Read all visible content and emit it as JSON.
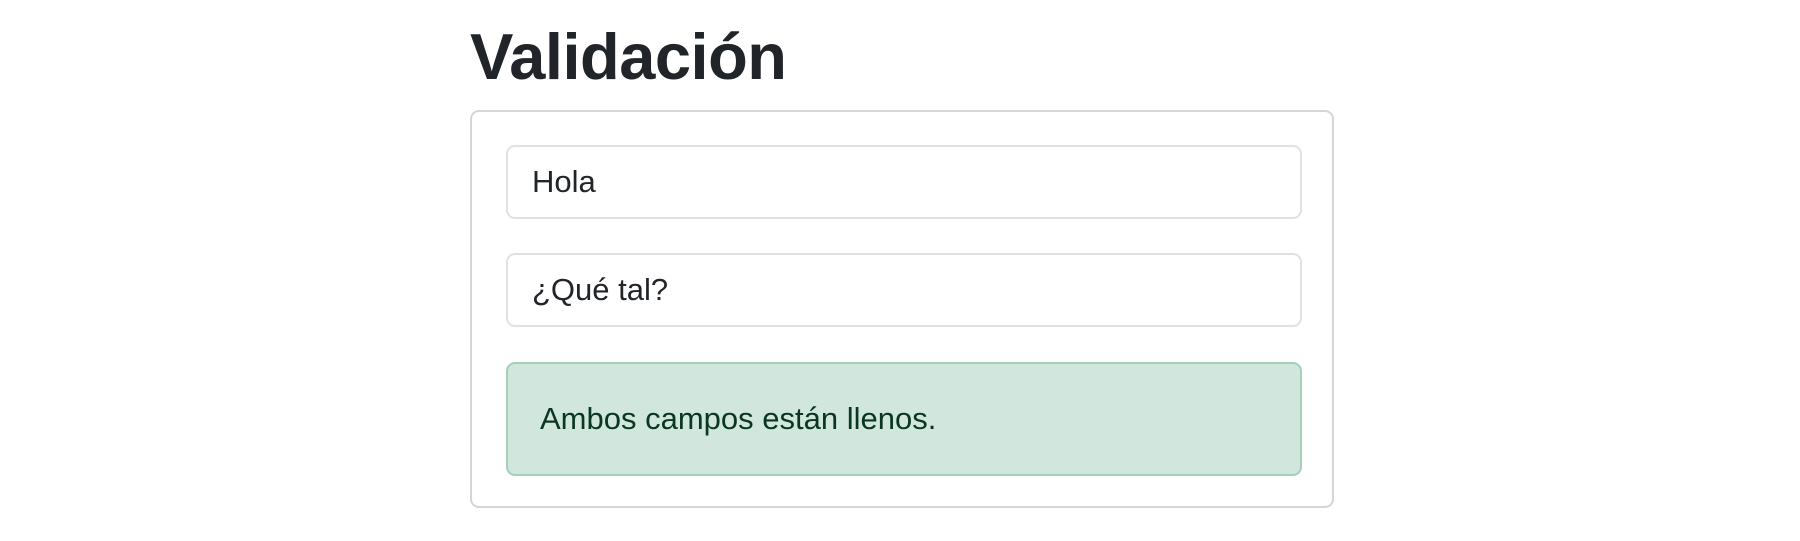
{
  "page": {
    "title": "Validación"
  },
  "form": {
    "field_1": {
      "value": "Hola"
    },
    "field_2": {
      "value": "¿Qué tal?"
    }
  },
  "alert": {
    "message": "Ambos campos están llenos.",
    "variant": "success",
    "colors": {
      "background": "#d1e7dd",
      "border": "#a3cfbb",
      "text": "#0a3622"
    }
  }
}
